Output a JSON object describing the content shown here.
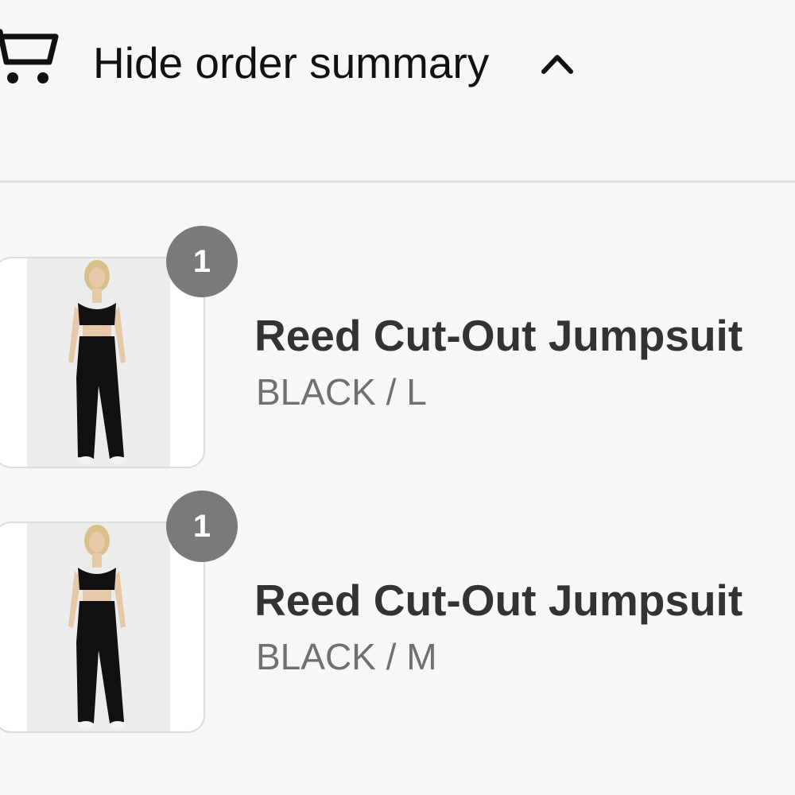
{
  "summary_toggle": {
    "label": "Hide order summary",
    "cart_icon": "cart-icon",
    "chevron_icon": "chevron-up-icon"
  },
  "line_items": [
    {
      "title": "Reed Cut-Out Jumpsuit",
      "variant": "BLACK / L",
      "quantity": "1",
      "image_icon": "product-image"
    },
    {
      "title": "Reed Cut-Out Jumpsuit",
      "variant": "BLACK / M",
      "quantity": "1",
      "image_icon": "product-image"
    }
  ],
  "colors": {
    "background": "#f7f7f7",
    "badge": "#7a7a7a",
    "divider": "#dedede",
    "title_text": "#333333",
    "variant_text": "#707070"
  }
}
